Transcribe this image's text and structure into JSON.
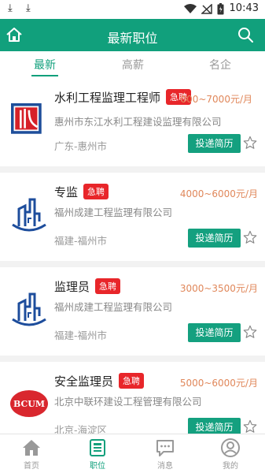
{
  "status_bar": {
    "time": "10:43"
  },
  "header": {
    "title": "最新职位"
  },
  "tabs": [
    {
      "label": "最新"
    },
    {
      "label": "高薪"
    },
    {
      "label": "名企"
    }
  ],
  "jobs": [
    {
      "title": "水利工程监理工程师",
      "badge": "急聘",
      "salary": "000~7000元/月",
      "company": "惠州市东江水利工程建设监理有限公司",
      "location": "广东-惠州市",
      "apply_label": "投递简历"
    },
    {
      "title": "专监",
      "badge": "急聘",
      "salary": "4000~6000元/月",
      "company": "福州成建工程监理有限公司",
      "location": "福建-福州市",
      "apply_label": "投递简历"
    },
    {
      "title": "监理员",
      "badge": "急聘",
      "salary": "3000~3500元/月",
      "company": "福州成建工程监理有限公司",
      "location": "福建-福州市",
      "apply_label": "投递简历"
    },
    {
      "title": "安全监理员",
      "badge": "急聘",
      "salary": "5000~6000元/月",
      "company": "北京中联环建设工程管理有限公司",
      "location": "北京-海淀区",
      "apply_label": "投递简历",
      "logo_text": "BCUM"
    }
  ],
  "bottom_nav": [
    {
      "label": "首页",
      "icon": "home-icon"
    },
    {
      "label": "职位",
      "icon": "job-list-icon"
    },
    {
      "label": "消息",
      "icon": "message-icon"
    },
    {
      "label": "我的",
      "icon": "profile-icon"
    }
  ],
  "colors": {
    "primary": "#11a07c",
    "badge": "#e8262a",
    "salary": "#e0875a"
  }
}
